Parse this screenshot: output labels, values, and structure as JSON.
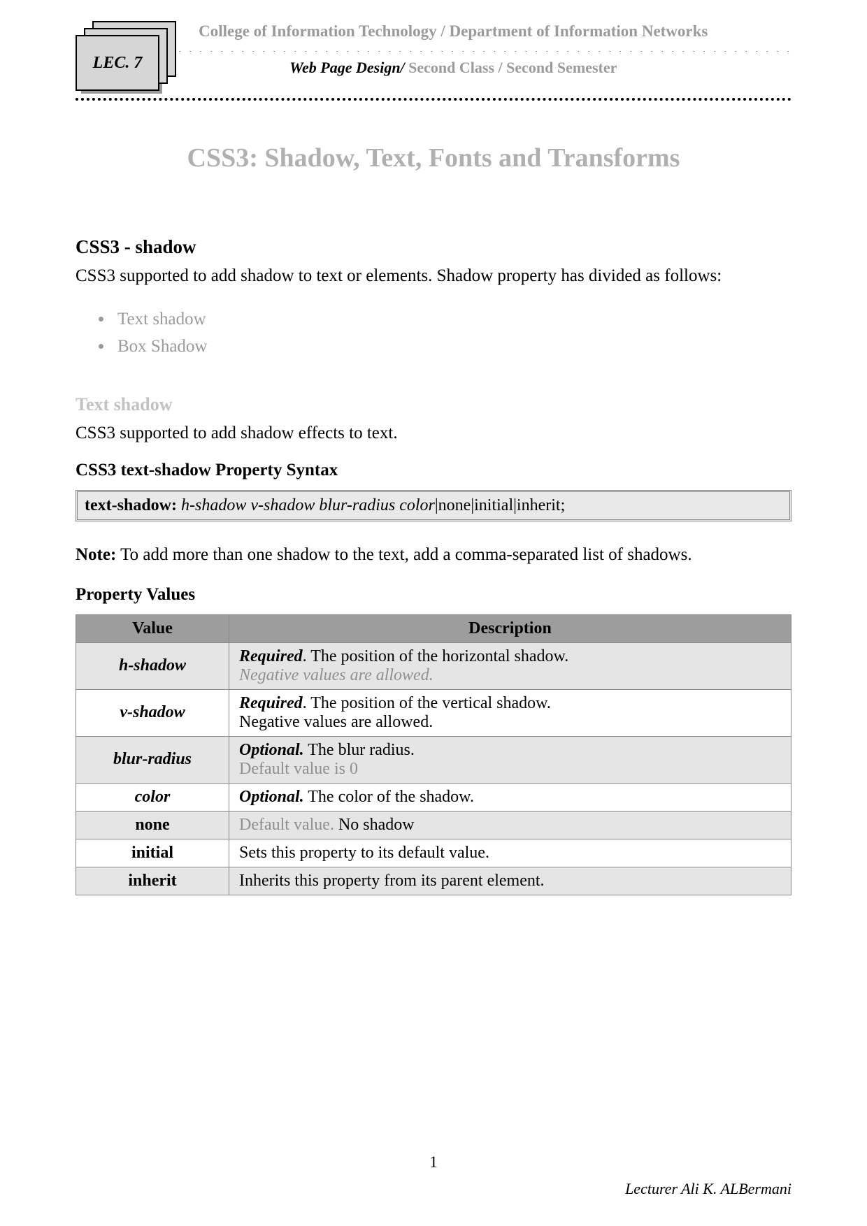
{
  "header": {
    "badge": "LEC. 7",
    "org_line": "College of Information Technology / Department of Information Networks",
    "course_part1": "Web Page Design/ ",
    "course_part2": "Second Class / ",
    "course_part3": "Second Semester"
  },
  "title": "CSS3: Shadow, Text, Fonts and Transforms",
  "section1": {
    "heading": "CSS3 - shadow",
    "intro": "CSS3 supported to add shadow to text or elements. Shadow property has divided as follows:",
    "items": [
      "Text shadow",
      "Box Shadow"
    ]
  },
  "section2": {
    "heading": "Text shadow",
    "intro": "CSS3 supported to add shadow effects to text.",
    "syntax_heading": "CSS3 text-shadow Property Syntax",
    "syntax_kw": "text-shadow: ",
    "syntax_italic": "h-shadow v-shadow blur-radius color",
    "syntax_rest": "|none|initial|inherit;",
    "note_label": "Note:",
    "note_text": " To add more than one shadow to the text, add a comma-separated list of shadows.",
    "values_heading": "Property Values",
    "table": {
      "col1": "Value",
      "col2": "Description",
      "rows": [
        {
          "value": "h-shadow",
          "italic": true,
          "alt": true,
          "desc_prefix": "Required",
          "desc_main": ". The position of the horizontal shadow.",
          "desc_extra": "Negative values are allowed.",
          "extra_style": "grayit"
        },
        {
          "value": "v-shadow",
          "italic": true,
          "alt": false,
          "desc_prefix": "Required",
          "desc_main": ". The position of the vertical shadow.",
          "desc_extra": "Negative values are allowed.",
          "extra_style": ""
        },
        {
          "value": "blur-radius",
          "italic": true,
          "alt": true,
          "desc_prefix": "Optional.",
          "desc_main": " The blur radius.",
          "desc_extra": "Default value is 0",
          "extra_style": "gray"
        },
        {
          "value": "color",
          "italic": true,
          "alt": false,
          "desc_prefix": "Optional.",
          "desc_main": " The color of the shadow.",
          "desc_extra": "",
          "extra_style": ""
        },
        {
          "value": "none",
          "italic": false,
          "alt": true,
          "desc_prefix_gray": "Default value.",
          "desc_main": " No shadow",
          "desc_extra": "",
          "extra_style": ""
        },
        {
          "value": "initial",
          "italic": false,
          "alt": false,
          "desc_main_only": "Sets this property to its default value."
        },
        {
          "value": "inherit",
          "italic": false,
          "alt": true,
          "desc_main_only": "Inherits this property from its parent element."
        }
      ]
    }
  },
  "footer": {
    "page_number": "1",
    "lecturer": "Lecturer  Ali K. ALBermani"
  }
}
